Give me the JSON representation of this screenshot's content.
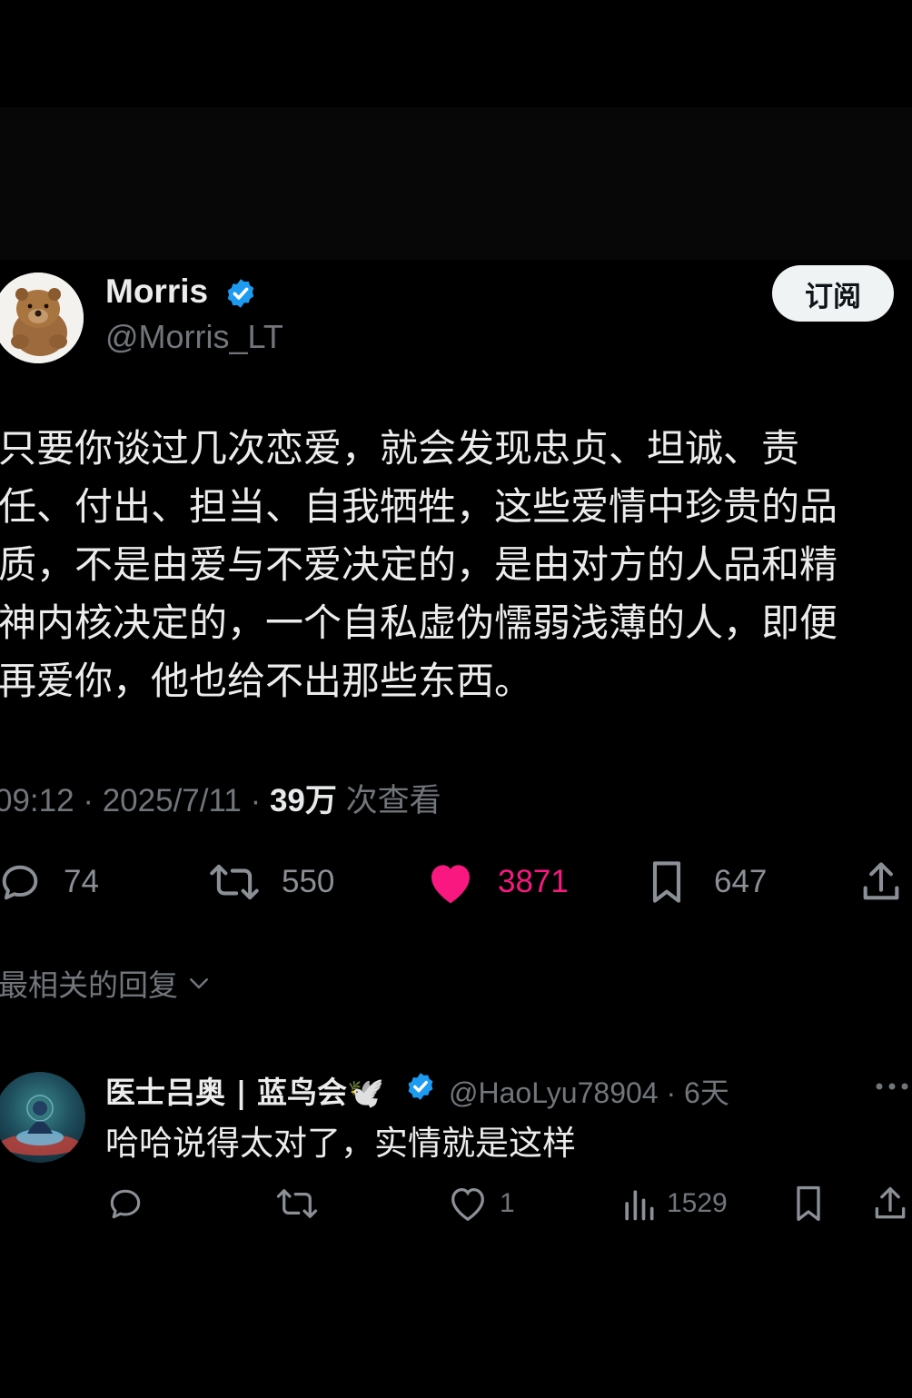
{
  "colors": {
    "background": "#000000",
    "verified_blue": "#1d9bf0",
    "like_pink": "#f91880",
    "secondary_text": "#71767b"
  },
  "tweet": {
    "display_name": "Morris",
    "handle": "@Morris_LT",
    "subscribe_label": "订阅",
    "text_lines": [
      "只要你谈过几次恋爱，就会发现忠贞、坦诚、责",
      "任、付出、担当、自我牺牲，这些爱情中珍贵的品",
      "质，不是由爱与不爱决定的，是由对方的人品和精",
      "神内核决定的，一个自私虚伪懦弱浅薄的人，即便",
      "再爱你，他也给不出那些东西。"
    ],
    "time": "09:12",
    "date": "2025/7/11",
    "views_count": "39万",
    "views_label": "次查看",
    "separator": "·",
    "actions": {
      "replies": "74",
      "reposts": "550",
      "likes": "3871",
      "bookmarks": "647"
    },
    "icons": [
      "reply-icon",
      "repost-icon",
      "like-filled-icon",
      "bookmark-icon",
      "share-icon"
    ]
  },
  "replies_section": {
    "sort_label": "最相关的回复"
  },
  "reply": {
    "display_name": "医士吕奥 | 蓝鸟会🕊️",
    "handle": "@HaoLyu78904",
    "age": "6天",
    "text": "哈哈说得太对了，实情就是这样",
    "actions": {
      "replies": "",
      "reposts": "",
      "likes": "1",
      "views": "1529"
    }
  }
}
